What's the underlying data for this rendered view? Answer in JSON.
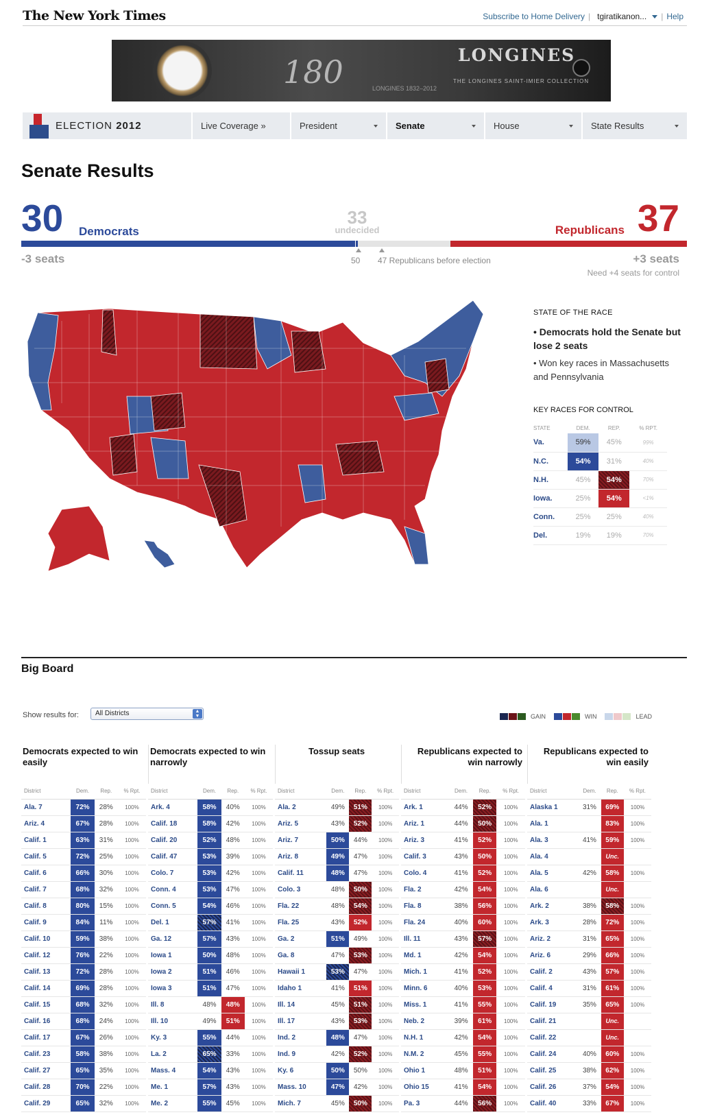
{
  "masthead": {
    "logo": "The New York Times",
    "subscribe": "Subscribe to Home Delivery",
    "user": "tgiratikanon...",
    "help": "Help"
  },
  "ad": {
    "number": "180",
    "small": "LONGINES 1832–2012",
    "brand": "LONGINES",
    "collection": "THE LONGINES SAINT-IMIER COLLECTION"
  },
  "nav": {
    "brand_prefix": "ELECTION",
    "brand_year": "2012",
    "items": [
      {
        "label": "Live Coverage »",
        "dropdown": false
      },
      {
        "label": "President",
        "dropdown": true
      },
      {
        "label": "Senate",
        "dropdown": true,
        "active": true
      },
      {
        "label": "House",
        "dropdown": true
      },
      {
        "label": "State Results",
        "dropdown": true
      }
    ]
  },
  "page_title": "Senate Results",
  "score": {
    "dem_count": "30",
    "dem_label": "Democrats",
    "undecided_count": "33",
    "undecided_label": "undecided",
    "rep_label": "Republicans",
    "rep_count": "37",
    "dem_change": "-3 seats",
    "rep_change": "+3 seats",
    "marker_50": "50",
    "marker_47": "47 Republicans before election",
    "control_note": "Need +4 seats for control",
    "dem_share": 0.506,
    "rep_share": 0.355,
    "colors": {
      "dem": "#2c4a9a",
      "rep": "#c2272d",
      "undecided": "#e4e4e4"
    }
  },
  "state_of_race": {
    "heading": "STATE OF THE RACE",
    "bullet1": "• Democrats hold the Senate but lose 2 seats",
    "bullet2": "• Won key races in Massachusetts and Pennsylvania"
  },
  "key_races": {
    "heading": "KEY RACES FOR CONTROL",
    "columns": [
      "STATE",
      "DEM.",
      "REP.",
      "% RPT."
    ],
    "rows": [
      {
        "state": "Va.",
        "dem": "59%",
        "rep": "45%",
        "rpt": "99%",
        "dem_style": "dl",
        "rep_style": ""
      },
      {
        "state": "N.C.",
        "dem": "54%",
        "rep": "31%",
        "rpt": "40%",
        "dem_style": "dw",
        "rep_style": ""
      },
      {
        "state": "N.H.",
        "dem": "45%",
        "rep": "54%",
        "rpt": "70%",
        "dem_style": "",
        "rep_style": "rg"
      },
      {
        "state": "Iowa.",
        "dem": "25%",
        "rep": "54%",
        "rpt": "<1%",
        "dem_style": "",
        "rep_style": "rw"
      },
      {
        "state": "Conn.",
        "dem": "25%",
        "rep": "25%",
        "rpt": "40%",
        "dem_style": "",
        "rep_style": ""
      },
      {
        "state": "Del.",
        "dem": "19%",
        "rep": "19%",
        "rpt": "70%",
        "dem_style": "",
        "rep_style": ""
      }
    ]
  },
  "big_board": {
    "title": "Big Board",
    "show_label": "Show results for:",
    "select_value": "All Districts",
    "legend": {
      "gain": "GAIN",
      "win": "WIN",
      "lead": "LEAD"
    },
    "subheaders": [
      "District",
      "Dem.",
      "Rep.",
      "% Rpt."
    ],
    "columns": [
      {
        "title": "Democrats expected to win easily",
        "align": "left",
        "rows": [
          [
            "Ala. 7",
            "72%",
            "28%",
            "100%",
            "d"
          ],
          [
            "Ariz. 4",
            "67%",
            "28%",
            "100%",
            "d"
          ],
          [
            "Calif. 1",
            "63%",
            "31%",
            "100%",
            "d"
          ],
          [
            "Calif. 5",
            "72%",
            "25%",
            "100%",
            "d"
          ],
          [
            "Calif. 6",
            "66%",
            "30%",
            "100%",
            "d"
          ],
          [
            "Calif. 7",
            "68%",
            "32%",
            "100%",
            "d"
          ],
          [
            "Calif. 8",
            "80%",
            "15%",
            "100%",
            "d"
          ],
          [
            "Calif. 9",
            "84%",
            "11%",
            "100%",
            "d"
          ],
          [
            "Calif. 10",
            "59%",
            "38%",
            "100%",
            "d"
          ],
          [
            "Calif. 12",
            "76%",
            "22%",
            "100%",
            "d"
          ],
          [
            "Calif. 13",
            "72%",
            "28%",
            "100%",
            "d"
          ],
          [
            "Calif. 14",
            "69%",
            "28%",
            "100%",
            "d"
          ],
          [
            "Calif. 15",
            "68%",
            "32%",
            "100%",
            "d"
          ],
          [
            "Calif. 16",
            "68%",
            "24%",
            "100%",
            "d"
          ],
          [
            "Calif. 17",
            "67%",
            "26%",
            "100%",
            "d"
          ],
          [
            "Calif. 23",
            "58%",
            "38%",
            "100%",
            "d"
          ],
          [
            "Calif. 27",
            "65%",
            "35%",
            "100%",
            "d"
          ],
          [
            "Calif. 28",
            "70%",
            "22%",
            "100%",
            "d"
          ],
          [
            "Calif. 29",
            "65%",
            "32%",
            "100%",
            "d"
          ]
        ]
      },
      {
        "title": "Democrats expected to win narrowly",
        "align": "left",
        "rows": [
          [
            "Ark. 4",
            "58%",
            "40%",
            "100%",
            "d"
          ],
          [
            "Calif. 18",
            "58%",
            "42%",
            "100%",
            "d"
          ],
          [
            "Calif. 20",
            "52%",
            "48%",
            "100%",
            "d"
          ],
          [
            "Calif. 47",
            "53%",
            "39%",
            "100%",
            "d"
          ],
          [
            "Colo. 7",
            "53%",
            "42%",
            "100%",
            "d"
          ],
          [
            "Conn. 4",
            "53%",
            "47%",
            "100%",
            "d"
          ],
          [
            "Conn. 5",
            "54%",
            "46%",
            "100%",
            "d"
          ],
          [
            "Del. 1",
            "57%",
            "41%",
            "100%",
            "dg"
          ],
          [
            "Ga. 12",
            "57%",
            "43%",
            "100%",
            "d"
          ],
          [
            "Iowa 1",
            "50%",
            "48%",
            "100%",
            "d"
          ],
          [
            "Iowa 2",
            "51%",
            "46%",
            "100%",
            "d"
          ],
          [
            "Iowa 3",
            "51%",
            "47%",
            "100%",
            "d"
          ],
          [
            "Ill. 8",
            "48%",
            "48%",
            "100%",
            "r"
          ],
          [
            "Ill. 10",
            "49%",
            "51%",
            "100%",
            "r"
          ],
          [
            "Ky. 3",
            "55%",
            "44%",
            "100%",
            "d"
          ],
          [
            "La. 2",
            "65%",
            "33%",
            "100%",
            "dg"
          ],
          [
            "Mass. 4",
            "54%",
            "43%",
            "100%",
            "d"
          ],
          [
            "Me. 1",
            "57%",
            "43%",
            "100%",
            "d"
          ],
          [
            "Me. 2",
            "55%",
            "45%",
            "100%",
            "d"
          ]
        ]
      },
      {
        "title": "Tossup seats",
        "align": "center",
        "rows": [
          [
            "Ala. 2",
            "49%",
            "51%",
            "100%",
            "rg"
          ],
          [
            "Ariz. 5",
            "43%",
            "52%",
            "100%",
            "rg"
          ],
          [
            "Ariz. 7",
            "50%",
            "44%",
            "100%",
            "d"
          ],
          [
            "Ariz. 8",
            "49%",
            "47%",
            "100%",
            "d"
          ],
          [
            "Calif. 11",
            "48%",
            "47%",
            "100%",
            "d"
          ],
          [
            "Colo. 3",
            "48%",
            "50%",
            "100%",
            "rg"
          ],
          [
            "Fla. 22",
            "48%",
            "54%",
            "100%",
            "rg"
          ],
          [
            "Fla. 25",
            "43%",
            "52%",
            "100%",
            "r"
          ],
          [
            "Ga. 2",
            "51%",
            "49%",
            "100%",
            "d"
          ],
          [
            "Ga. 8",
            "47%",
            "53%",
            "100%",
            "rg"
          ],
          [
            "Hawaii 1",
            "53%",
            "47%",
            "100%",
            "dg"
          ],
          [
            "Idaho 1",
            "41%",
            "51%",
            "100%",
            "r"
          ],
          [
            "Ill. 14",
            "45%",
            "51%",
            "100%",
            "rg"
          ],
          [
            "Ill. 17",
            "43%",
            "53%",
            "100%",
            "rg"
          ],
          [
            "Ind. 2",
            "48%",
            "47%",
            "100%",
            "d"
          ],
          [
            "Ind. 9",
            "42%",
            "52%",
            "100%",
            "rg"
          ],
          [
            "Ky. 6",
            "50%",
            "50%",
            "100%",
            "d"
          ],
          [
            "Mass. 10",
            "47%",
            "42%",
            "100%",
            "d"
          ],
          [
            "Mich. 7",
            "45%",
            "50%",
            "100%",
            "rg"
          ]
        ]
      },
      {
        "title": "Republicans expected to win narrowly",
        "align": "right",
        "rows": [
          [
            "Ark. 1",
            "44%",
            "52%",
            "100%",
            "rg"
          ],
          [
            "Ariz. 1",
            "44%",
            "50%",
            "100%",
            "rg"
          ],
          [
            "Ariz. 3",
            "41%",
            "52%",
            "100%",
            "r"
          ],
          [
            "Calif. 3",
            "43%",
            "50%",
            "100%",
            "r"
          ],
          [
            "Colo. 4",
            "41%",
            "52%",
            "100%",
            "r"
          ],
          [
            "Fla. 2",
            "42%",
            "54%",
            "100%",
            "r"
          ],
          [
            "Fla. 8",
            "38%",
            "56%",
            "100%",
            "r"
          ],
          [
            "Fla. 24",
            "40%",
            "60%",
            "100%",
            "r"
          ],
          [
            "Ill. 11",
            "43%",
            "57%",
            "100%",
            "rg"
          ],
          [
            "Md. 1",
            "42%",
            "54%",
            "100%",
            "r"
          ],
          [
            "Mich. 1",
            "41%",
            "52%",
            "100%",
            "r"
          ],
          [
            "Minn. 6",
            "40%",
            "53%",
            "100%",
            "r"
          ],
          [
            "Miss. 1",
            "41%",
            "55%",
            "100%",
            "r"
          ],
          [
            "Neb. 2",
            "39%",
            "61%",
            "100%",
            "r"
          ],
          [
            "N.H. 1",
            "42%",
            "54%",
            "100%",
            "r"
          ],
          [
            "N.M. 2",
            "45%",
            "55%",
            "100%",
            "r"
          ],
          [
            "Ohio 1",
            "48%",
            "51%",
            "100%",
            "r"
          ],
          [
            "Ohio 15",
            "41%",
            "54%",
            "100%",
            "r"
          ],
          [
            "Pa. 3",
            "44%",
            "56%",
            "100%",
            "rg"
          ]
        ]
      },
      {
        "title": "Republicans expected to win easily",
        "align": "right",
        "rows": [
          [
            "Alaska 1",
            "31%",
            "69%",
            "100%",
            "r"
          ],
          [
            "Ala. 1",
            "",
            "83%",
            "100%",
            "r"
          ],
          [
            "Ala. 3",
            "41%",
            "59%",
            "100%",
            "r"
          ],
          [
            "Ala. 4",
            "",
            "Unc.",
            "",
            "ru"
          ],
          [
            "Ala. 5",
            "42%",
            "58%",
            "100%",
            "r"
          ],
          [
            "Ala. 6",
            "",
            "Unc.",
            "",
            "ru"
          ],
          [
            "Ark. 2",
            "38%",
            "58%",
            "100%",
            "rg"
          ],
          [
            "Ark. 3",
            "28%",
            "72%",
            "100%",
            "r"
          ],
          [
            "Ariz. 2",
            "31%",
            "65%",
            "100%",
            "r"
          ],
          [
            "Ariz. 6",
            "29%",
            "66%",
            "100%",
            "r"
          ],
          [
            "Calif. 2",
            "43%",
            "57%",
            "100%",
            "r"
          ],
          [
            "Calif. 4",
            "31%",
            "61%",
            "100%",
            "r"
          ],
          [
            "Calif. 19",
            "35%",
            "65%",
            "100%",
            "r"
          ],
          [
            "Calif. 21",
            "",
            "Unc.",
            "",
            "ru"
          ],
          [
            "Calif. 22",
            "",
            "Unc.",
            "",
            "ru"
          ],
          [
            "Calif. 24",
            "40%",
            "60%",
            "100%",
            "r"
          ],
          [
            "Calif. 25",
            "38%",
            "62%",
            "100%",
            "r"
          ],
          [
            "Calif. 26",
            "37%",
            "54%",
            "100%",
            "r"
          ],
          [
            "Calif. 40",
            "33%",
            "67%",
            "100%",
            "r"
          ]
        ]
      }
    ]
  }
}
